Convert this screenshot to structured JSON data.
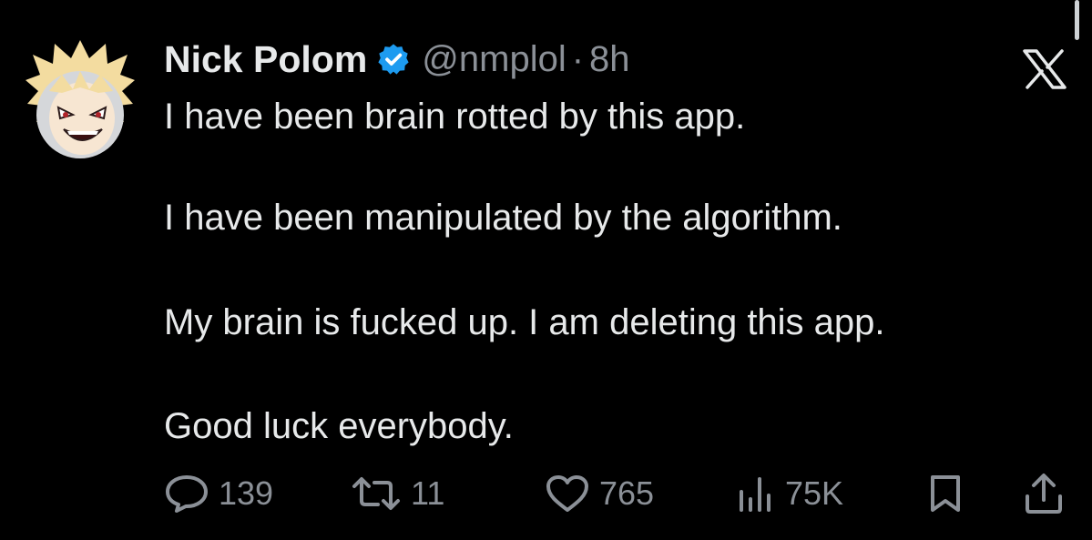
{
  "tweet": {
    "author": {
      "name": "Nick Polom",
      "handle": "@nmplol",
      "separator": "·",
      "time": "8h"
    },
    "paragraphs": [
      "I have been brain rotted by this app.",
      "I have been manipulated by the algorithm.",
      "My brain is fucked up. I am deleting this app.",
      "Good luck everybody."
    ]
  },
  "actions": {
    "replies": "139",
    "reposts": "11",
    "likes": "765",
    "views": "75K"
  },
  "colors": {
    "background": "#000000",
    "text": "#e7e9ea",
    "muted": "#8b9097",
    "verified_badge": "#1d9bf0"
  },
  "icons": [
    "avatar",
    "verified-badge-icon",
    "x-logo-icon",
    "reply-icon",
    "repost-icon",
    "like-icon",
    "views-icon",
    "bookmark-icon",
    "share-icon"
  ]
}
